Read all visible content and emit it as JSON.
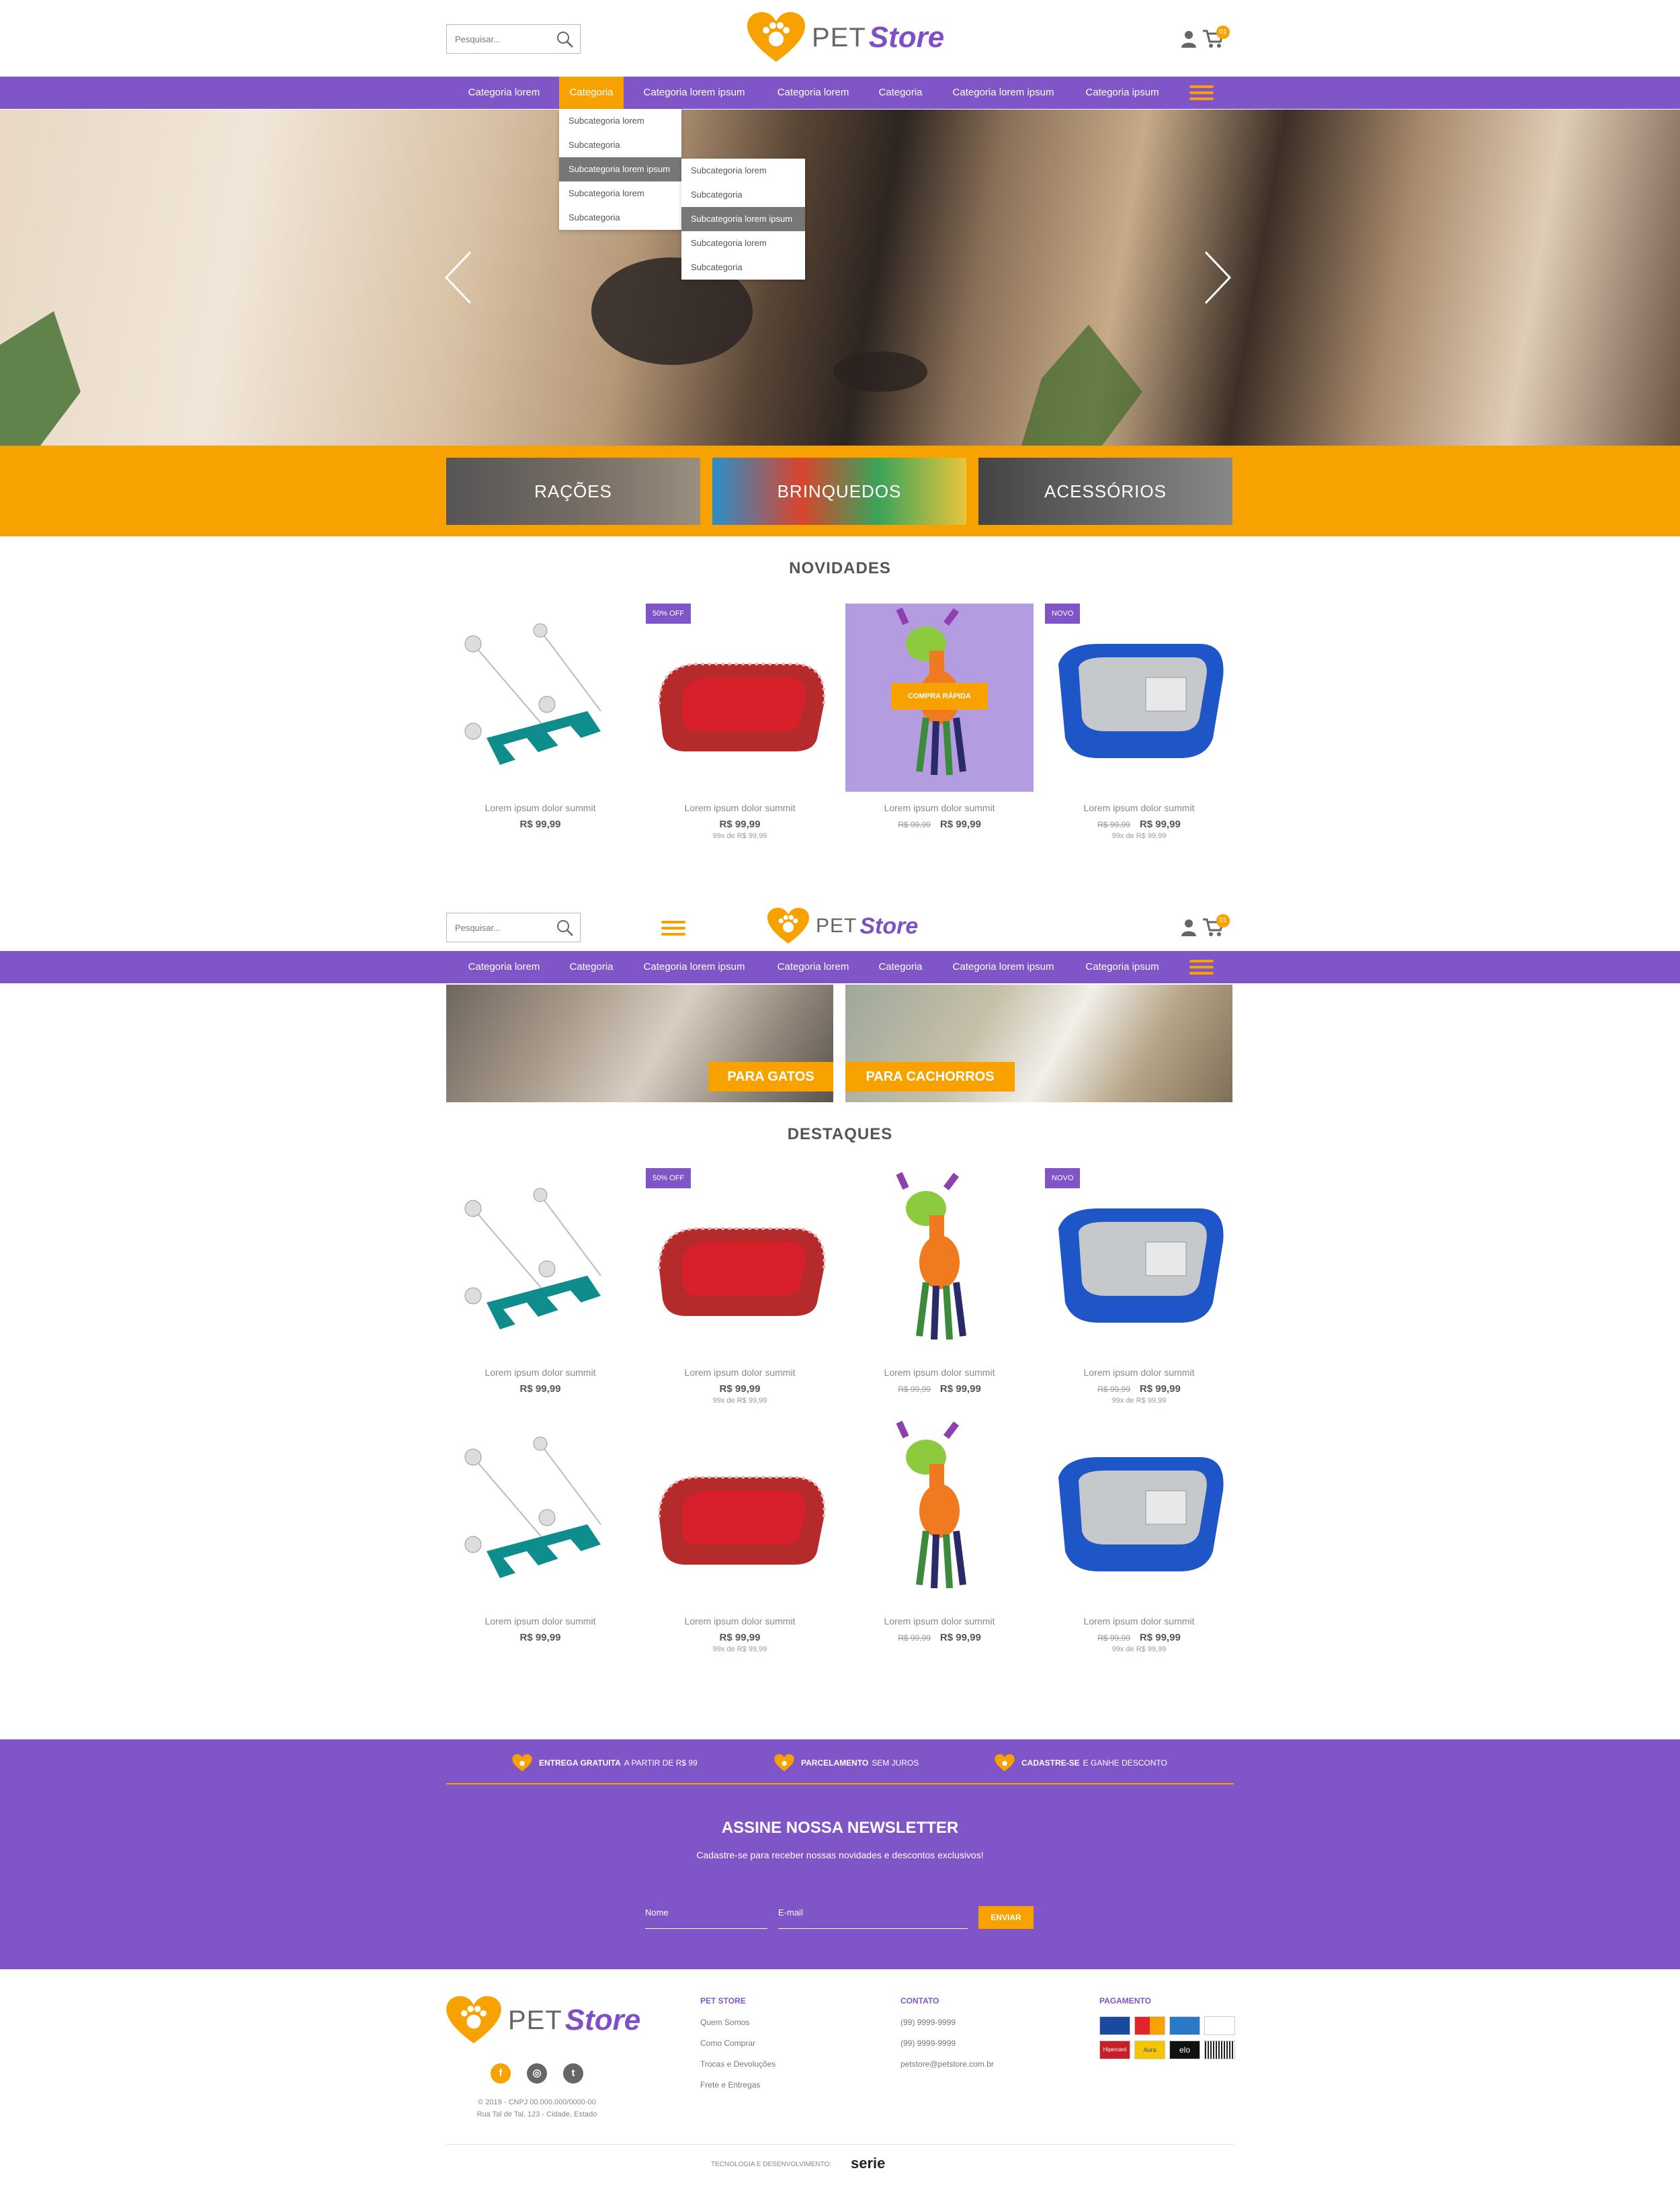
{
  "header": {
    "search_placeholder": "Pesquisar...",
    "logo_pet": "PET",
    "logo_store": "Store",
    "cart_count": "01"
  },
  "nav": [
    "Categoria lorem",
    "Categoria",
    "Categoria lorem ipsum",
    "Categoria lorem",
    "Categoria",
    "Categoria lorem ipsum",
    "Categoria ipsum"
  ],
  "dropdown1": [
    "Subcategoria lorem",
    "Subcategoria",
    "Subcategoria lorem ipsum",
    "Subcategoria lorem",
    "Subcategoria"
  ],
  "dropdown2": [
    "Subcategoria lorem",
    "Subcategoria",
    "Subcategoria lorem ipsum",
    "Subcategoria lorem",
    "Subcategoria"
  ],
  "categories": [
    "RAÇÕES",
    "BRINQUEDOS",
    "ACESSÓRIOS"
  ],
  "novidades_title": "NOVIDADES",
  "destaques_title": "DESTAQUES",
  "products": [
    {
      "name": "Lorem ipsum dolor summit",
      "price": "R$ 99,99",
      "old": "",
      "inst": "",
      "tag": ""
    },
    {
      "name": "Lorem ipsum dolor summit",
      "price": "R$ 99,99",
      "old": "",
      "inst": "99x de R$ 99,99",
      "tag": "50% OFF"
    },
    {
      "name": "Lorem ipsum dolor summit",
      "price": "R$ 99,99",
      "old": "R$ 99,99",
      "inst": "",
      "tag": ""
    },
    {
      "name": "Lorem ipsum dolor summit",
      "price": "R$ 99,99",
      "old": "R$ 99,99",
      "inst": "99x de R$ 99,99",
      "tag": "NOVO"
    }
  ],
  "quick_buy": "COMPRA RÁPIDA",
  "pets": {
    "cats": "PARA GATOS",
    "dogs": "PARA CACHORROS"
  },
  "benefits": [
    {
      "bold": "ENTREGA GRATUITA",
      "rest": "A PARTIR DE R$ 99"
    },
    {
      "bold": "PARCELAMENTO",
      "rest": "SEM JUROS"
    },
    {
      "bold": "CADASTRE-SE",
      "rest": "E GANHE DESCONTO"
    }
  ],
  "newsletter": {
    "title": "ASSINE NOSSA NEWSLETTER",
    "subtitle": "Cadastre-se para receber nossas novidades e descontos exclusivos!",
    "name": "Nome",
    "email": "E-mail",
    "send": "ENVIAR"
  },
  "footer": {
    "copyright": "© 2019 - CNPJ 00.000.000/0000-00",
    "address": "Rua Tal de Tal, 123 - Cidade, Estado",
    "col1": {
      "title": "PET STORE",
      "links": [
        "Quem Somos",
        "Como Comprar",
        "Trocas e Devoluções",
        "Frete e Entregas"
      ]
    },
    "col2": {
      "title": "CONTATO",
      "links": [
        "(99) 9999-9999",
        "(99) 9999-9999",
        "petstore@petstore.com.br"
      ]
    },
    "col3": {
      "title": "PAGAMENTO"
    },
    "cards": [
      "Hipercard",
      "Aura",
      "elo"
    ],
    "dev_label": "TECNOLOGIA E DESENVOLVIMENTO:",
    "dev_brand": "serie"
  },
  "colors": {
    "purple": "#7f55c7",
    "orange": "#f7a200"
  }
}
